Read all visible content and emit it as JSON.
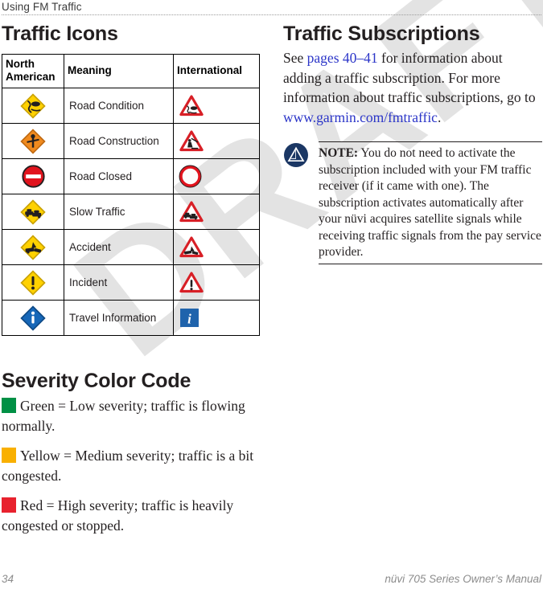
{
  "running_header": {
    "text": "Using FM Traffic"
  },
  "left_column": {
    "heading": "Traffic Icons",
    "table": {
      "columns": [
        "North American",
        "Meaning",
        "International"
      ],
      "rows": [
        {
          "meaning": "Road Condition",
          "na_icon": "yellow-diamond-slippery-road-icon",
          "intl_icon": "red-triangle-slippery-road-icon"
        },
        {
          "meaning": "Road Construction",
          "na_icon": "orange-diamond-construction-icon",
          "intl_icon": "red-triangle-roadworks-icon"
        },
        {
          "meaning": "Road Closed",
          "na_icon": "red-circle-do-not-enter-icon",
          "intl_icon": "red-ring-no-entry-icon"
        },
        {
          "meaning": "Slow Traffic",
          "na_icon": "yellow-diamond-slow-traffic-icon",
          "intl_icon": "red-triangle-queue-icon"
        },
        {
          "meaning": "Accident",
          "na_icon": "yellow-diamond-accident-icon",
          "intl_icon": "red-triangle-accident-icon"
        },
        {
          "meaning": "Incident",
          "na_icon": "yellow-diamond-exclamation-icon",
          "intl_icon": "red-triangle-exclamation-icon"
        },
        {
          "meaning": "Travel Information",
          "na_icon": "blue-diamond-information-icon",
          "intl_icon": "blue-square-information-icon"
        }
      ]
    },
    "severity": {
      "heading": "Severity Color Code",
      "items": [
        {
          "color": "#009045",
          "swatch_name": "green-severity-swatch",
          "text": "Green = Low severity; traffic is flowing normally."
        },
        {
          "color": "#f9b000",
          "swatch_name": "yellow-severity-swatch",
          "text": "Yellow = Medium severity; traffic is a bit congested."
        },
        {
          "color": "#e8222e",
          "swatch_name": "red-severity-swatch",
          "text": "Red = High severity; traffic is heavily congested or stopped."
        }
      ]
    }
  },
  "right_column": {
    "heading": "Traffic Subscriptions",
    "paragraph": {
      "part1": "See ",
      "link1": "pages 40–41",
      "part2": " for information about adding a traffic subscription. For more information about traffic subscriptions, go to ",
      "link2": "www.garmin.com/fmtraffic",
      "part3": "."
    },
    "note": {
      "icon": "garmin-note-icon",
      "label": "NOTE:",
      "text": " You do not need to activate the subscription included with your FM traffic receiver (if it came with one). The subscription activates automatically after your nüvi acquires satellite signals while receiving traffic signals from the pay service provider."
    }
  },
  "footer": {
    "page_number": "34",
    "manual_title": "nüvi 705 Series Owner’s Manual"
  },
  "watermark": {
    "text": "DRAFT"
  },
  "colors": {
    "link": "#2b35c8",
    "note_navy": "#1b3764",
    "rule_gray": "#9b9b9b",
    "footer_gray": "#8c8c8c"
  }
}
